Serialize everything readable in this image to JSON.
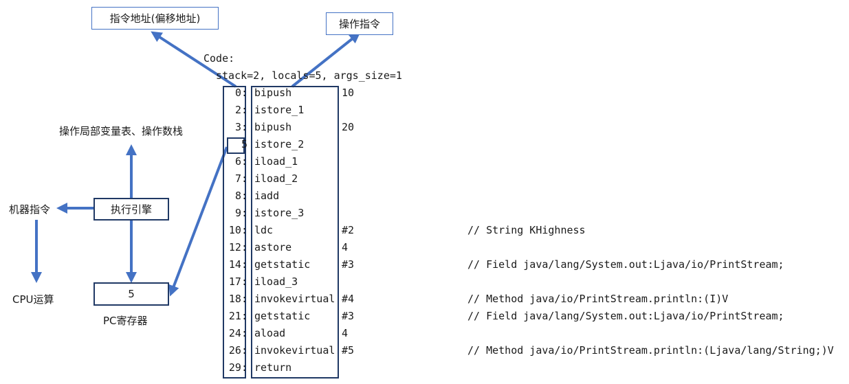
{
  "callouts": {
    "address": "指令地址(偏移地址)",
    "operation": "操作指令"
  },
  "code_header": {
    "code_label": "Code:",
    "stack_line": "stack=2, locals=5, args_size=1"
  },
  "engine": {
    "box_label": "执行引擎",
    "up_label": "操作局部变量表、操作数栈",
    "left_label": "机器指令",
    "down_left_label": "CPU运算",
    "pc_value": "5",
    "pc_label": "PC寄存器"
  },
  "colors": {
    "arrow": "#4472c4",
    "box_border": "#1f3864"
  },
  "instructions": [
    {
      "offset": "0:",
      "op": "bipush",
      "arg": "10",
      "comment": ""
    },
    {
      "offset": "2:",
      "op": "istore_1",
      "arg": "",
      "comment": ""
    },
    {
      "offset": "3:",
      "op": "bipush",
      "arg": "20",
      "comment": ""
    },
    {
      "offset": "5",
      "op": "istore_2",
      "arg": "",
      "comment": ""
    },
    {
      "offset": "6:",
      "op": "iload_1",
      "arg": "",
      "comment": ""
    },
    {
      "offset": "7:",
      "op": "iload_2",
      "arg": "",
      "comment": ""
    },
    {
      "offset": "8:",
      "op": "iadd",
      "arg": "",
      "comment": ""
    },
    {
      "offset": "9:",
      "op": "istore_3",
      "arg": "",
      "comment": ""
    },
    {
      "offset": "10:",
      "op": "ldc",
      "arg": "#2",
      "comment": "// String KHighness"
    },
    {
      "offset": "12:",
      "op": "astore",
      "arg": "4",
      "comment": ""
    },
    {
      "offset": "14:",
      "op": "getstatic",
      "arg": "#3",
      "comment": "// Field java/lang/System.out:Ljava/io/PrintStream;"
    },
    {
      "offset": "17:",
      "op": "iload_3",
      "arg": "",
      "comment": ""
    },
    {
      "offset": "18:",
      "op": "invokevirtual",
      "arg": "#4",
      "comment": "// Method java/io/PrintStream.println:(I)V"
    },
    {
      "offset": "21:",
      "op": "getstatic",
      "arg": "#3",
      "comment": "// Field java/lang/System.out:Ljava/io/PrintStream;"
    },
    {
      "offset": "24:",
      "op": "aload",
      "arg": "4",
      "comment": ""
    },
    {
      "offset": "26:",
      "op": "invokevirtual",
      "arg": "#5",
      "comment": "// Method java/io/PrintStream.println:(Ljava/lang/String;)V"
    },
    {
      "offset": "29:",
      "op": "return",
      "arg": "",
      "comment": ""
    }
  ]
}
